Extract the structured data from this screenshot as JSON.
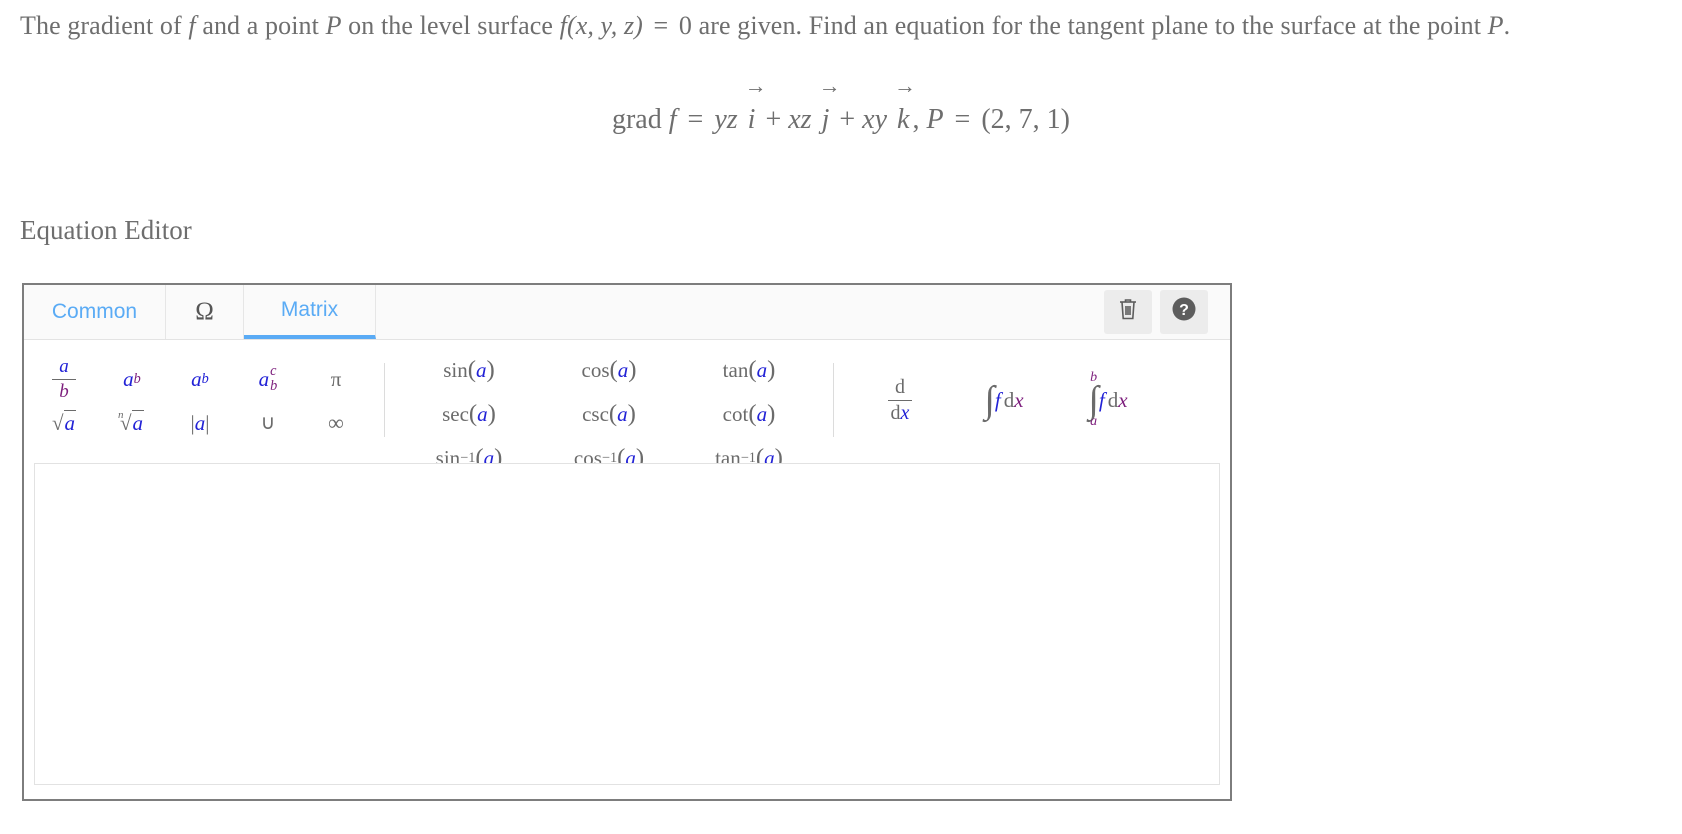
{
  "question": {
    "part1": "The gradient of",
    "f1": "f",
    "part2": "and a point",
    "P1": "P",
    "part3": "on the level surface",
    "fxyz": "f",
    "args": "(x, y, z)",
    "eq": "=",
    "zero": "0",
    "part4": "are given. Find an equation for the tangent plane to the surface at the point",
    "P2": "P",
    "period": "."
  },
  "formula": {
    "grad": "grad",
    "f": "f",
    "equals": "=",
    "term1_coef": "yz",
    "term1_vec": "i",
    "plus1": "+",
    "term2_coef": "xz",
    "term2_vec": "j",
    "plus2": "+",
    "term3_coef": "xy",
    "term3_vec": "k",
    "comma": ",",
    "point_label": "P",
    "point_equals": "=",
    "point_value": "(2, 7, 1)",
    "arrow": "→"
  },
  "editor": {
    "title": "Equation Editor",
    "tabs": [
      {
        "label": "Common",
        "active": false
      },
      {
        "label": "Ω",
        "active": false
      },
      {
        "label": "Matrix",
        "active": true
      }
    ],
    "tools": [
      {
        "name": "trash",
        "label": ""
      },
      {
        "name": "help",
        "label": "?"
      }
    ],
    "palette": {
      "basic": [
        {
          "name": "fraction",
          "num": "a",
          "den": "b"
        },
        {
          "name": "power",
          "base": "a",
          "sup": "b"
        },
        {
          "name": "subscript",
          "base": "a",
          "sub": "b"
        },
        {
          "name": "sub-superscript",
          "base": "a",
          "sup": "c",
          "sub": "b"
        },
        {
          "name": "pi",
          "glyph": "π"
        },
        {
          "name": "square-root",
          "radicand": "a"
        },
        {
          "name": "nth-root",
          "index": "n",
          "radicand": "a"
        },
        {
          "name": "absolute-value",
          "arg": "a"
        },
        {
          "name": "union",
          "glyph": "∪"
        },
        {
          "name": "infinity",
          "glyph": "∞"
        }
      ],
      "trig": [
        {
          "name": "sin",
          "fn": "sin",
          "arg": "a"
        },
        {
          "name": "sec",
          "fn": "sec",
          "arg": "a"
        },
        {
          "name": "arcsin",
          "fn": "sin",
          "sup": "−1",
          "arg": "a"
        },
        {
          "name": "cos",
          "fn": "cos",
          "arg": "a"
        },
        {
          "name": "csc",
          "fn": "csc",
          "arg": "a"
        },
        {
          "name": "arccos",
          "fn": "cos",
          "sup": "−1",
          "arg": "a"
        },
        {
          "name": "tan",
          "fn": "tan",
          "arg": "a"
        },
        {
          "name": "cot",
          "fn": "cot",
          "arg": "a"
        },
        {
          "name": "arctan",
          "fn": "tan",
          "sup": "−1",
          "arg": "a"
        }
      ],
      "calculus": [
        {
          "name": "derivative",
          "num": "d",
          "den_d": "d",
          "den_var": "x"
        },
        {
          "name": "indefinite-integral",
          "sign": "∫",
          "f": "f",
          "d": "d",
          "var": "x"
        },
        {
          "name": "definite-integral",
          "sign": "∫",
          "upper": "b",
          "lower": "a",
          "f": "f",
          "d": "d",
          "var": "x"
        }
      ]
    },
    "input_value": "",
    "colors": {
      "accent": "#5aabf5",
      "blue_var": "#2222d6",
      "purple_var": "#7d1f7d",
      "text": "#6b6b6b",
      "panel_border": "#7d7d7d"
    }
  }
}
